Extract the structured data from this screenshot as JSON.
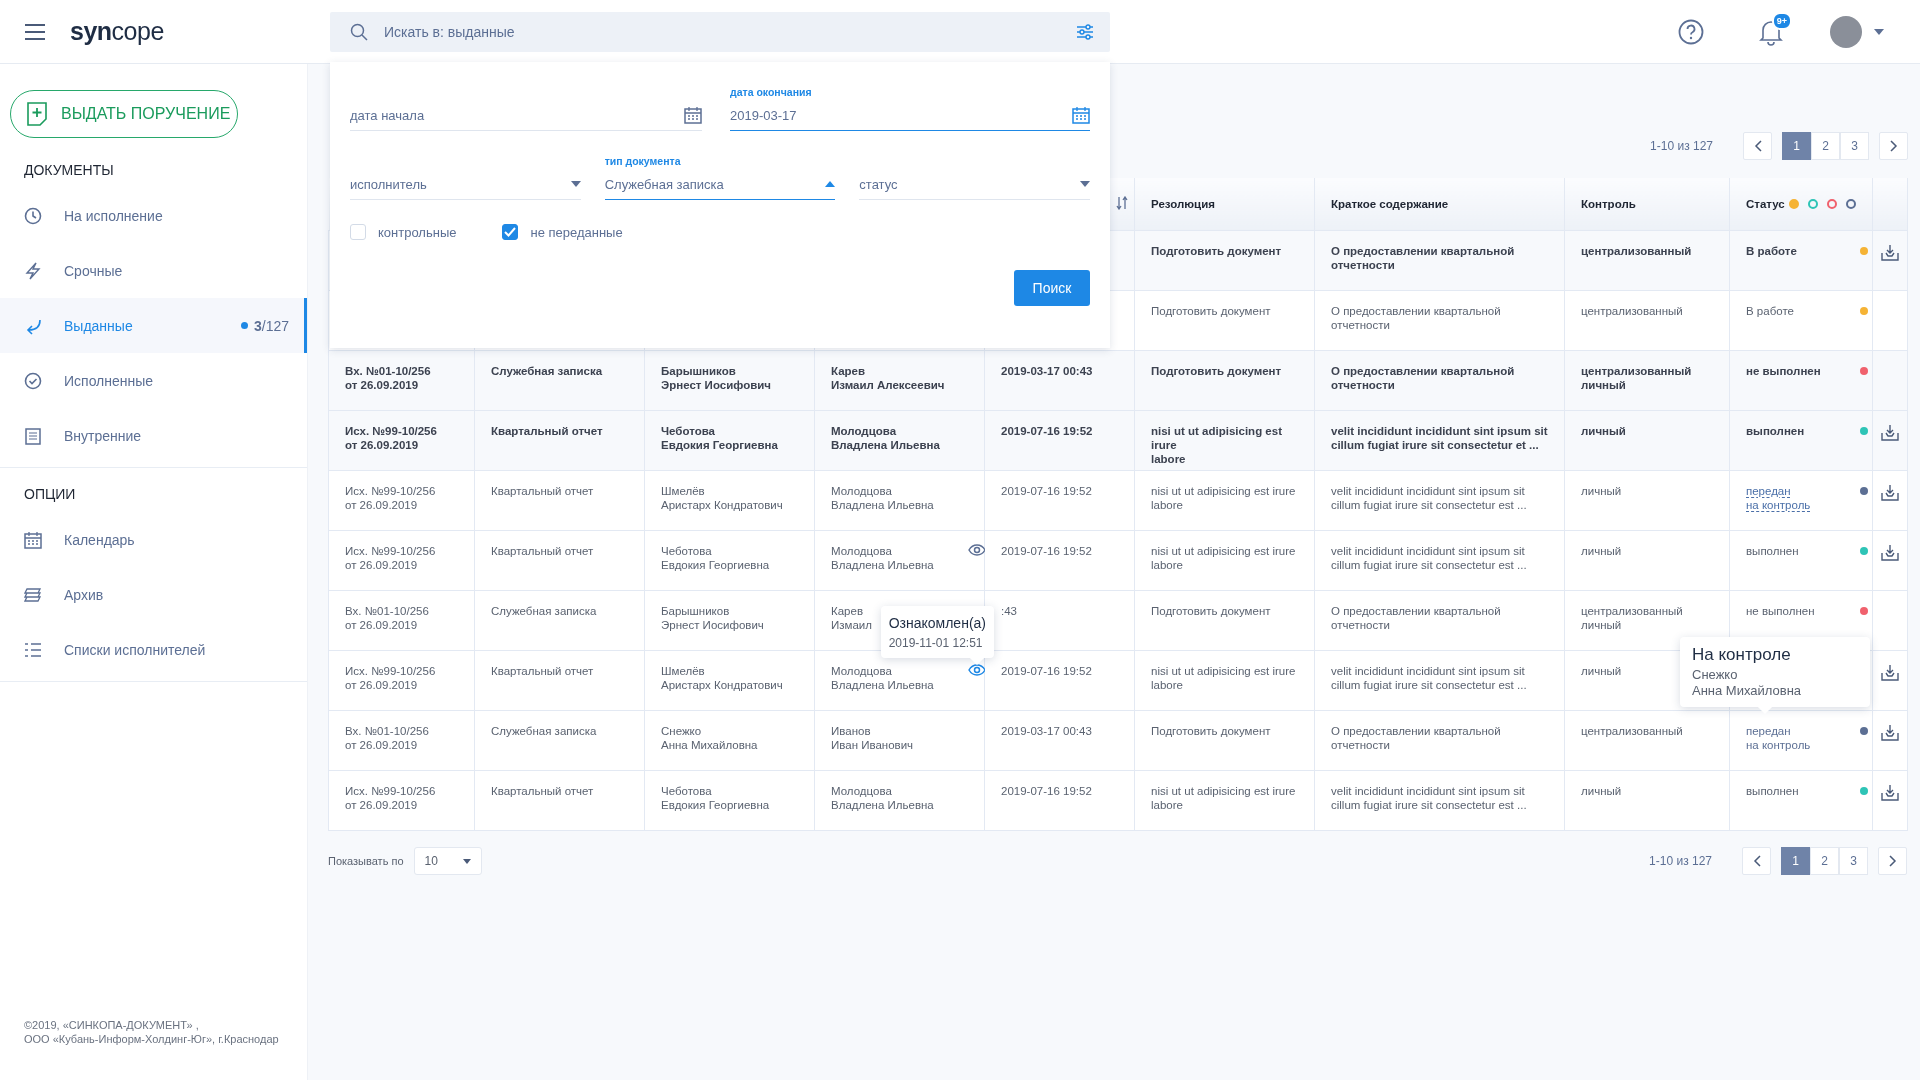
{
  "topbar": {
    "logo": "**syn**cope",
    "search": {
      "placeholder": "Искать в: выданные"
    },
    "notifications": {
      "badge": "9+"
    }
  },
  "sidebar": {
    "action": "ВЫДАТЬ ПОРУЧЕНИЕ",
    "sections": [
      {
        "title": "ДОКУМЕНТЫ",
        "items": [
          {
            "label": "На исполнение",
            "selected": false
          },
          {
            "label": "Срочные",
            "selected": false
          },
          {
            "label": "Выданные",
            "selected": true,
            "count": "**3**/127"
          },
          {
            "label": "Исполненные",
            "selected": false
          },
          {
            "label": "Внутренние",
            "selected": false
          }
        ]
      },
      {
        "title": "ОПЦИИ",
        "items": [
          {
            "label": "Календарь",
            "selected": false
          },
          {
            "label": "Архив",
            "selected": false
          },
          {
            "label": "Списки исполнителей",
            "selected": false
          }
        ]
      }
    ],
    "footer": [
      "©2019,  «СИНКОПА-ДОКУМЕНТ» ,",
      "ООО «Кубань-Информ-Холдинг-Юг», г.Краснодар"
    ]
  },
  "filter": {
    "rows": [
      [
        {
          "kind": "date",
          "placeholder": "дата начала",
          "focused": false
        },
        {
          "kind": "date",
          "label": "дата окончания",
          "value": "2019-03-17",
          "focused": true
        }
      ],
      [
        {
          "kind": "select",
          "placeholder": "исполнитель",
          "open": false
        },
        {
          "kind": "select",
          "label": "тип документа",
          "value": "Служебная записка",
          "open": true
        },
        {
          "kind": "select",
          "placeholder": "статус",
          "open": false
        }
      ]
    ],
    "checkboxes": [
      {
        "label": "контрольные",
        "checked": false
      },
      {
        "label": "не переданные",
        "checked": true
      }
    ],
    "button": "Поиск"
  },
  "pagination": {
    "range": "1-10 из 127",
    "pages": [
      {
        "label": "1",
        "selected": true
      },
      {
        "label": "2",
        "selected": false
      },
      {
        "label": "3",
        "selected": false
      }
    ]
  },
  "table": {
    "columns": [
      {
        "label": "Резолюция"
      },
      {
        "label": "Краткое содержание"
      },
      {
        "label": "Контроль"
      },
      {
        "label": "Статус"
      }
    ],
    "status_legend": [
      {
        "color": "#f5b335",
        "selected": true
      },
      {
        "color": "#2ec4b6",
        "selected": false
      },
      {
        "color": "#f0616d",
        "selected": false
      },
      {
        "color": "#5c6f94",
        "selected": false
      }
    ],
    "rows": [
      {
        "unread": true,
        "resolution": "Подготовить документ",
        "summary": "О предоставлении квартальной\nотчетности",
        "control": "централизованный",
        "status": {
          "text": "В работе",
          "color": "#f5b335",
          "link": false
        },
        "downloadable": true
      },
      {
        "unread": false,
        "resolution": "Подготовить документ",
        "summary": "О предоставлении квартальной\nотчетности",
        "control": "централизованный",
        "status": {
          "text": "В работе",
          "color": "#f5b335",
          "link": false
        },
        "downloadable": false
      },
      {
        "unread": true,
        "number": "Вх. №01-10/256\nот 26.09.2019",
        "doc_type": "Служебная записка",
        "author": "Барышников\nЭрнест Иосифович",
        "executor": "Карев\nИзмаил Алексеевич",
        "date": "2019-03-17 00:43",
        "resolution": "Подготовить документ",
        "summary": "О предоставлении квартальной\nотчетности",
        "control": "централизованный\nличный",
        "status": {
          "text": "не выполнен",
          "color": "#f0616d",
          "link": false
        },
        "downloadable": false
      },
      {
        "unread": true,
        "number": "Исх. №99-10/256\nот 26.09.2019",
        "doc_type": "Квартальный отчет",
        "author": "Чеботова\nЕвдокия Георгиевна",
        "executor": "Молодцова\nВладлена Ильевна",
        "date": "2019-07-16 19:52",
        "resolution": "nisi ut ut adipisicing est irure\nlabore",
        "summary": "velit incididunt incididunt sint ipsum sit\ncillum fugiat irure sit consectetur et ...",
        "control": "личный",
        "status": {
          "text": "выполнен",
          "color": "#2ec4b6",
          "link": false
        },
        "downloadable": true
      },
      {
        "unread": false,
        "number": "Исх. №99-10/256\nот 26.09.2019",
        "doc_type": "Квартальный отчет",
        "author": "Шмелёв\nАристарх Кондратович",
        "executor": "Молодцова\nВладлена Ильевна",
        "date": "2019-07-16 19:52",
        "resolution": "nisi ut ut adipisicing est irure\nlabore",
        "summary": "velit incididunt incididunt sint ipsum sit\ncillum fugiat irure sit consectetur est ...",
        "control": "личный",
        "status": {
          "text": "передан\nна контроль",
          "color": "#5c6f94",
          "link": true,
          "underlined": true
        },
        "downloadable": true
      },
      {
        "unread": false,
        "number": "Исх. №99-10/256\nот 26.09.2019",
        "doc_type": "Квартальный отчет",
        "author": "Чеботова\nЕвдокия Георгиевна",
        "executor": "Молодцова\nВладлена Ильевна",
        "viewed": {
          "active": false
        },
        "date": "2019-07-16 19:52",
        "resolution": "nisi ut ut adipisicing est irure\nlabore",
        "summary": "velit incididunt incididunt sint ipsum sit\ncillum fugiat irure sit consectetur est ...",
        "control": "личный",
        "status": {
          "text": "выполнен",
          "color": "#2ec4b6",
          "link": false
        },
        "downloadable": true
      },
      {
        "unread": false,
        "number": "Вх. №01-10/256\nот 26.09.2019",
        "doc_type": "Служебная записка",
        "author": "Барышников\nЭрнест Иосифович",
        "executor": "Карев\nИзмаил",
        "date": ":43",
        "resolution": "Подготовить документ",
        "summary": "О предоставлении квартальной\nотчетности",
        "control": "централизованный\nличный",
        "status": {
          "text": "не выполнен",
          "color": "#f0616d",
          "link": false
        },
        "downloadable": false
      },
      {
        "unread": false,
        "number": "Исх. №99-10/256\nот 26.09.2019",
        "doc_type": "Квартальный отчет",
        "author": "Шмелёв\nАристарх Кондратович",
        "executor": "Молодцова\nВладлена Ильевна",
        "viewed": {
          "active": true,
          "tooltip": {
            "title": "Ознакомлен(а)",
            "text": "2019-11-01 12:51"
          }
        },
        "date": "2019-07-16 19:52",
        "resolution": "nisi ut ut adipisicing est irure\nlabore",
        "summary": "velit incididunt incididunt sint ipsum sit\ncillum fugiat irure sit consectetur est ...",
        "control": "личный",
        "downloadable": true
      },
      {
        "unread": false,
        "number": "Вх. №01-10/256\nот 26.09.2019",
        "doc_type": "Служебная записка",
        "author": "Снежко\nАнна Михайловна",
        "executor": "Иванов\nИван Иванович",
        "date": "2019-03-17 00:43",
        "resolution": "Подготовить документ",
        "summary": "О предоставлении квартальной\nотчетности",
        "control": "централизованный",
        "status": {
          "text": "передан\nна контроль",
          "color": "#5c6f94",
          "link": true,
          "underlined": false,
          "tooltip": {
            "title": "На контроле",
            "text": "Снежко\nАнна Михайловна"
          }
        },
        "downloadable": true
      },
      {
        "unread": false,
        "number": "Исх. №99-10/256\nот 26.09.2019",
        "doc_type": "Квартальный отчет",
        "author": "Чеботова\nЕвдокия Георгиевна",
        "executor": "Молодцова\nВладлена Ильевна",
        "date": "2019-07-16 19:52",
        "resolution": "nisi ut ut adipisicing est irure\nlabore",
        "summary": "velit incididunt incididunt sint ipsum sit\ncillum fugiat irure sit consectetur est ...",
        "control": "личный",
        "status": {
          "text": "выполнен",
          "color": "#2ec4b6",
          "link": false
        },
        "downloadable": true
      }
    ]
  },
  "footer": {
    "page_size_label": "Показывать по",
    "page_size": "10",
    "pagination": {
      "range": "1-10 из 127",
      "pages": [
        {
          "label": "1",
          "selected": true
        },
        {
          "label": "2",
          "selected": false
        },
        {
          "label": "3",
          "selected": false
        }
      ]
    }
  }
}
